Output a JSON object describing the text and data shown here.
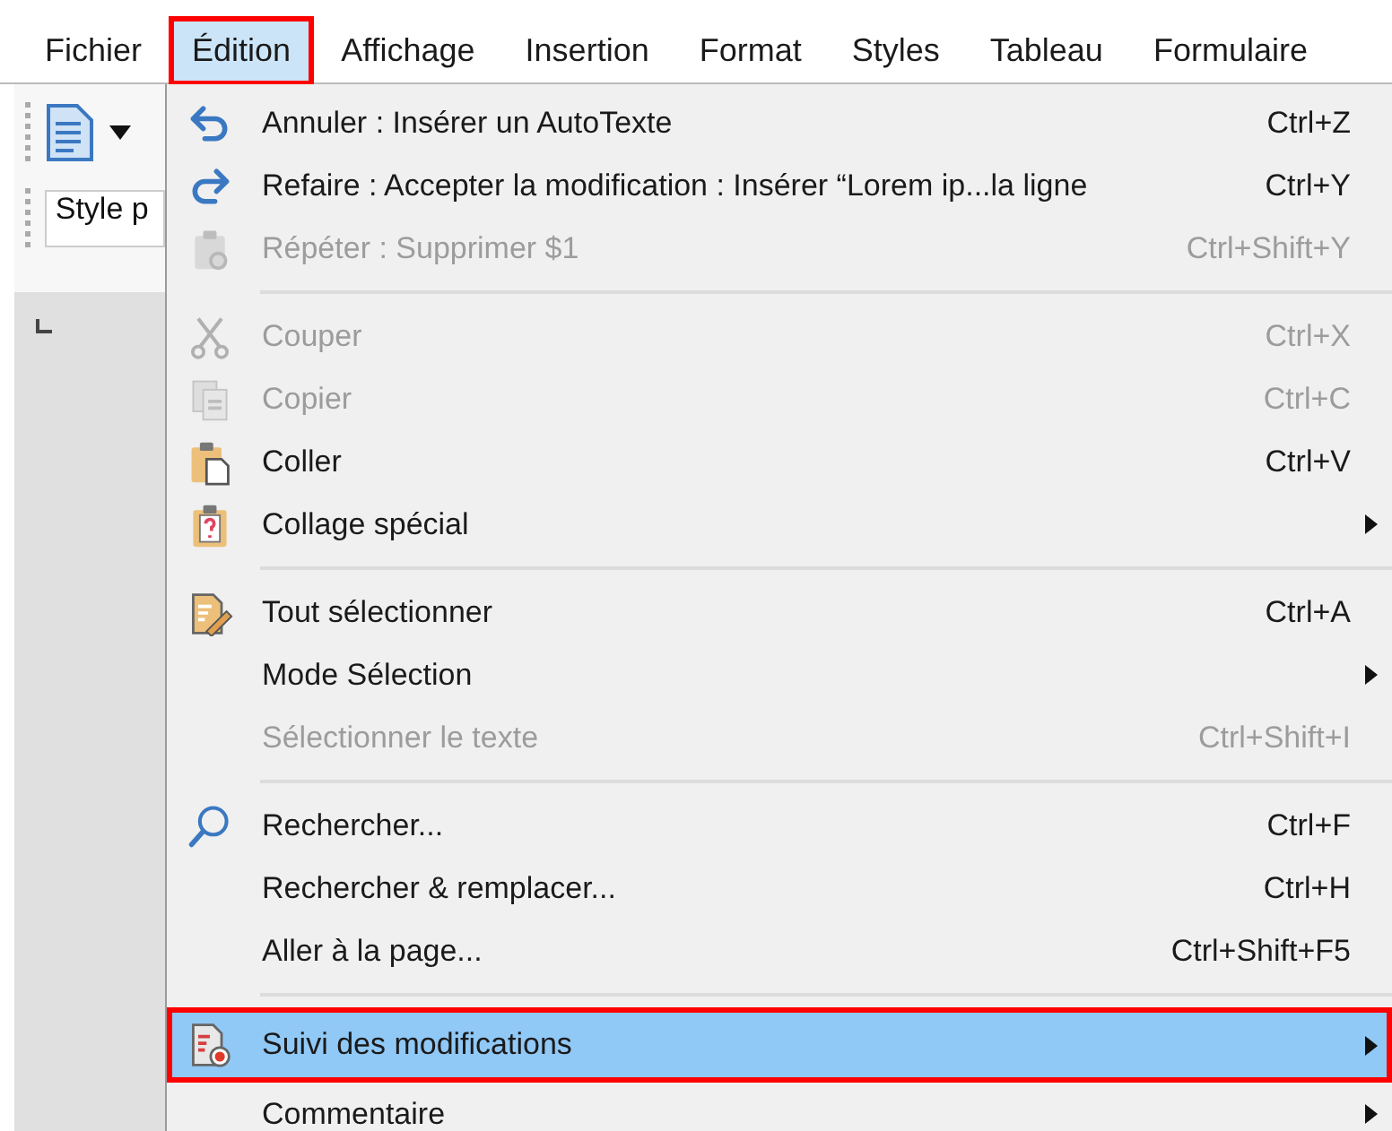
{
  "menubar": [
    {
      "label": "Fichier",
      "selected": false,
      "outlined": false
    },
    {
      "label": "Édition",
      "selected": true,
      "outlined": true
    },
    {
      "label": "Affichage",
      "selected": false,
      "outlined": false
    },
    {
      "label": "Insertion",
      "selected": false,
      "outlined": false
    },
    {
      "label": "Format",
      "selected": false,
      "outlined": false
    },
    {
      "label": "Styles",
      "selected": false,
      "outlined": false
    },
    {
      "label": "Tableau",
      "selected": false,
      "outlined": false
    },
    {
      "label": "Formulaire",
      "selected": false,
      "outlined": false
    }
  ],
  "toolbar": {
    "style_field": {
      "value": "Style p"
    }
  },
  "menu": {
    "items": [
      {
        "kind": "item",
        "label": "Annuler : Insérer un AutoTexte",
        "shortcut": "Ctrl+Z",
        "submenu": false,
        "disabled": false,
        "selected": false,
        "outlined": false
      },
      {
        "kind": "item",
        "label": "Refaire : Accepter la modification : Insérer “Lorem ip...la ligne",
        "shortcut": "Ctrl+Y",
        "submenu": false,
        "disabled": false,
        "selected": false,
        "outlined": false
      },
      {
        "kind": "item",
        "label": "Répéter : Supprimer $1",
        "shortcut": "Ctrl+Shift+Y",
        "submenu": false,
        "disabled": true,
        "selected": false,
        "outlined": false
      },
      {
        "kind": "separator"
      },
      {
        "kind": "item",
        "label": "Couper",
        "shortcut": "Ctrl+X",
        "submenu": false,
        "disabled": true,
        "selected": false,
        "outlined": false
      },
      {
        "kind": "item",
        "label": "Copier",
        "shortcut": "Ctrl+C",
        "submenu": false,
        "disabled": true,
        "selected": false,
        "outlined": false
      },
      {
        "kind": "item",
        "label": "Coller",
        "shortcut": "Ctrl+V",
        "submenu": false,
        "disabled": false,
        "selected": false,
        "outlined": false
      },
      {
        "kind": "item",
        "label": "Collage spécial",
        "submenu": true,
        "disabled": false,
        "selected": false,
        "outlined": false
      },
      {
        "kind": "separator"
      },
      {
        "kind": "item",
        "label": "Tout sélectionner",
        "shortcut": "Ctrl+A",
        "submenu": false,
        "disabled": false,
        "selected": false,
        "outlined": false
      },
      {
        "kind": "item",
        "label": "Mode Sélection",
        "submenu": true,
        "disabled": false,
        "selected": false,
        "outlined": false
      },
      {
        "kind": "item",
        "label": "Sélectionner le texte",
        "shortcut": "Ctrl+Shift+I",
        "submenu": false,
        "disabled": true,
        "selected": false,
        "outlined": false
      },
      {
        "kind": "separator"
      },
      {
        "kind": "item",
        "label": "Rechercher...",
        "shortcut": "Ctrl+F",
        "submenu": false,
        "disabled": false,
        "selected": false,
        "outlined": false
      },
      {
        "kind": "item",
        "label": "Rechercher & remplacer...",
        "shortcut": "Ctrl+H",
        "submenu": false,
        "disabled": false,
        "selected": false,
        "outlined": false
      },
      {
        "kind": "item",
        "label": "Aller à la page...",
        "shortcut": "Ctrl+Shift+F5",
        "submenu": false,
        "disabled": false,
        "selected": false,
        "outlined": false
      },
      {
        "kind": "separator"
      },
      {
        "kind": "item",
        "label": "Suivi des modifications",
        "submenu": true,
        "disabled": false,
        "selected": true,
        "outlined": true
      },
      {
        "kind": "item",
        "label": "Commentaire",
        "submenu": true,
        "disabled": false,
        "selected": false,
        "outlined": false
      }
    ]
  }
}
